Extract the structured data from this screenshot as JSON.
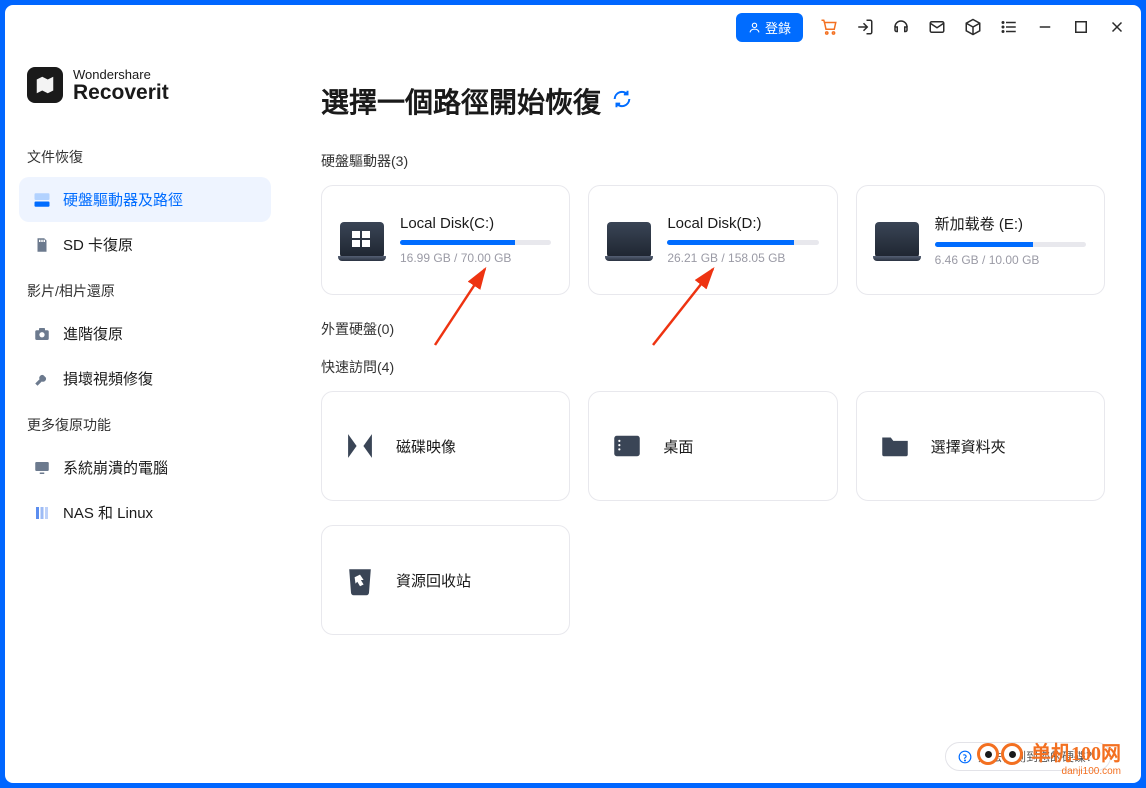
{
  "brand": {
    "line1": "Wondershare",
    "line2": "Recoverit"
  },
  "titlebar": {
    "login": "登錄"
  },
  "sidebar": {
    "sec1": "文件恢復",
    "item1": "硬盤驅動器及路徑",
    "item2": "SD 卡復原",
    "sec2": "影片/相片還原",
    "item3": "進階復原",
    "item4": "損壞視頻修復",
    "sec3": "更多復原功能",
    "item5": "系統崩潰的電腦",
    "item6": "NAS 和 Linux"
  },
  "main": {
    "title": "選擇一個路徑開始恢復",
    "drives_label": "硬盤驅動器(3)",
    "external_label": "外置硬盤(0)",
    "quick_label": "快速訪問(4)"
  },
  "drives": [
    {
      "name": "Local Disk(C:)",
      "used": "16.99 GB",
      "total": "70.00 GB",
      "pct": 76
    },
    {
      "name": "Local Disk(D:)",
      "used": "26.21 GB",
      "total": "158.05 GB",
      "pct": 84
    },
    {
      "name": "新加载卷 (E:)",
      "used": "6.46 GB",
      "total": "10.00 GB",
      "pct": 65
    }
  ],
  "quick": [
    {
      "label": "磁碟映像"
    },
    {
      "label": "桌面"
    },
    {
      "label": "選擇資料夾"
    },
    {
      "label": "資源回收站"
    }
  ],
  "help": "無法檢測到您的硬碟？",
  "watermark": {
    "name": "单机100网",
    "url": "danji100.com"
  }
}
